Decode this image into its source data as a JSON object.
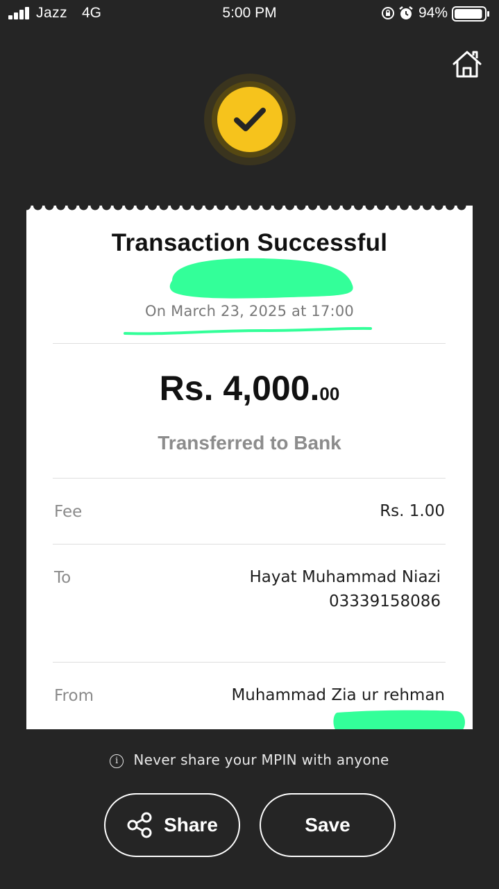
{
  "status_bar": {
    "carrier": "Jazz",
    "network": "4G",
    "time": "5:00 PM",
    "battery_percent": "94%",
    "battery_level": 0.94
  },
  "header": {
    "home_icon": "home-icon",
    "success_icon": "checkmark-icon",
    "accent_color": "#f6c31c"
  },
  "receipt": {
    "title": "Transaction Successful",
    "date": "On March 23, 2025 at 17:00",
    "amount_main": "Rs. 4,000.",
    "amount_cents": "00",
    "transfer_type": "Transferred to Bank",
    "fee": {
      "label": "Fee",
      "value": "Rs. 1.00"
    },
    "to": {
      "label": "To",
      "name": "Hayat Muhammad Niazi",
      "number": "03339158086"
    },
    "from": {
      "label": "From",
      "name": "Muhammad Zia ur rehman"
    },
    "redaction_color": "#33ff99"
  },
  "notice": {
    "icon": "info-icon",
    "text": "Never share your MPIN with anyone"
  },
  "actions": {
    "share_label": "Share",
    "save_label": "Save"
  }
}
